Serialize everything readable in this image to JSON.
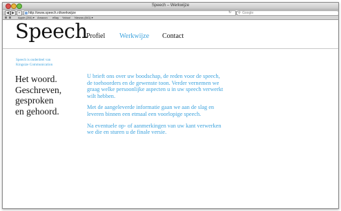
{
  "window": {
    "title": "Speech – Werkwijze"
  },
  "toolbar": {
    "back": "◀",
    "forward": "▶",
    "plus": "+",
    "url": "http://www.speech.nl/werkwijze",
    "search_placeholder": "Google",
    "reload": "↻"
  },
  "bookmarks": [
    {
      "label": "Apple (204) ▾"
    },
    {
      "label": "Amazon"
    },
    {
      "label": "eBay"
    },
    {
      "label": "Yahoo!"
    },
    {
      "label": "Nieuws (841) ▾"
    }
  ],
  "site": {
    "logo": "Speech",
    "nav": {
      "profiel": "Profiel",
      "werkwijze": "Werkwijze",
      "contact": "Contact"
    },
    "subtitle_line1": "Speech is onderdeel van",
    "subtitle_line2": "Kingsize Communication",
    "tagline": [
      "Het woord.",
      "Geschreven,",
      "gesproken",
      "en gehoord."
    ],
    "paragraphs": [
      "U brieft ons over uw boodschap, de reden voor de speech, de toehoorders en de gewenste toon. Verder vernemen we graag welke persoonlijke aspecten u in uw speech verwerkt wilt hebben.",
      "Met de aangeleverde informatie gaan we aan de slag en leveren binnen een etmaal een voorlopige speech.",
      "Na eventuele op- of aanmerkingen van uw kant verwerken we die en sturen u de finale versie."
    ]
  },
  "colors": {
    "accent": "#3ca2dd",
    "text": "#111111"
  }
}
